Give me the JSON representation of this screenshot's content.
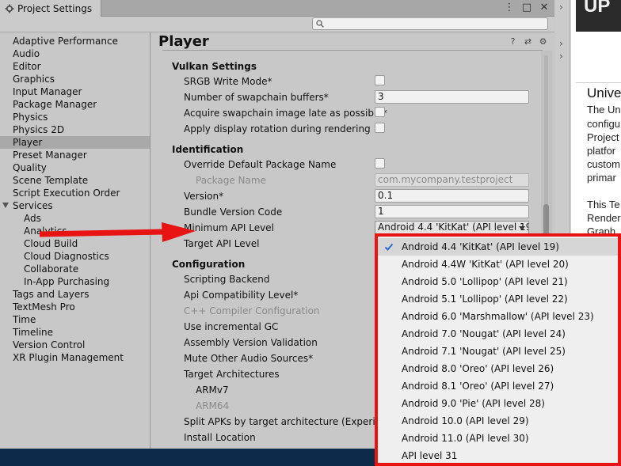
{
  "window": {
    "tab_label": "Project Settings",
    "icon": "gear-icon"
  },
  "sidebar": {
    "items": [
      {
        "label": "Adaptive Performance"
      },
      {
        "label": "Audio"
      },
      {
        "label": "Editor"
      },
      {
        "label": "Graphics"
      },
      {
        "label": "Input Manager"
      },
      {
        "label": "Package Manager"
      },
      {
        "label": "Physics"
      },
      {
        "label": "Physics 2D"
      },
      {
        "label": "Player",
        "selected": true
      },
      {
        "label": "Preset Manager"
      },
      {
        "label": "Quality"
      },
      {
        "label": "Scene Template"
      },
      {
        "label": "Script Execution Order"
      },
      {
        "label": "Services",
        "expanded": true
      },
      {
        "label": "Ads"
      },
      {
        "label": "Analytics"
      },
      {
        "label": "Cloud Build"
      },
      {
        "label": "Cloud Diagnostics"
      },
      {
        "label": "Collaborate"
      },
      {
        "label": "In-App Purchasing"
      },
      {
        "label": "Tags and Layers"
      },
      {
        "label": "TextMesh Pro"
      },
      {
        "label": "Time"
      },
      {
        "label": "Timeline"
      },
      {
        "label": "Version Control"
      },
      {
        "label": "XR Plugin Management"
      }
    ]
  },
  "main": {
    "title": "Player",
    "vulkan": {
      "header": "Vulkan Settings",
      "srgb_write_mode": "SRGB Write Mode*",
      "swapchain_buffers": "Number of swapchain buffers*",
      "swapchain_buffers_value": "3",
      "acquire_late": "Acquire swapchain image late as possible*",
      "apply_rotation": "Apply display rotation during rendering"
    },
    "identification": {
      "header": "Identification",
      "override_package": "Override Default Package Name",
      "package_name": "Package Name",
      "package_name_value": "com.mycompany.testproject",
      "version": "Version*",
      "version_value": "0.1",
      "bundle_version_code": "Bundle Version Code",
      "bundle_version_code_value": "1",
      "min_api": "Minimum API Level",
      "min_api_value": "Android 4.4 'KitKat' (API level 19)",
      "target_api": "Target API Level"
    },
    "configuration": {
      "header": "Configuration",
      "scripting_backend": "Scripting Backend",
      "api_compat": "Api Compatibility Level*",
      "cpp_compiler": "C++ Compiler Configuration",
      "incremental_gc": "Use incremental GC",
      "assembly_validation": "Assembly Version Validation",
      "mute_audio": "Mute Other Audio Sources*",
      "target_arch": "Target Architectures",
      "armv7": "ARMv7",
      "arm64": "ARM64",
      "split_apks": "Split APKs by target architecture (Experime",
      "install_location": "Install Location"
    }
  },
  "popup": {
    "options": [
      "Android 4.4 'KitKat' (API level 19)",
      "Android 4.4W 'KitKat' (API level 20)",
      "Android 5.0 'Lollipop' (API level 21)",
      "Android 5.1 'Lollipop' (API level 22)",
      "Android 6.0 'Marshmallow' (API level 23)",
      "Android 7.0 'Nougat' (API level 24)",
      "Android 7.1 'Nougat' (API level 25)",
      "Android 8.0 'Oreo' (API level 26)",
      "Android 8.1 'Oreo' (API level 27)",
      "Android 9.0 'Pie' (API level 28)",
      "Android 10.0 (API level 29)",
      "Android 11.0 (API level 30)",
      "API level 31"
    ],
    "selected_index": 0
  },
  "docs": {
    "banner": "UP",
    "title": "Unive",
    "lines": [
      "The Un",
      "configu",
      "Project",
      "platfor",
      "custom",
      "primar",
      "",
      "This Te",
      "Render",
      "Graph"
    ]
  },
  "colors": {
    "highlight_red": "#e81313",
    "selection_gray": "#a9a9a9"
  }
}
